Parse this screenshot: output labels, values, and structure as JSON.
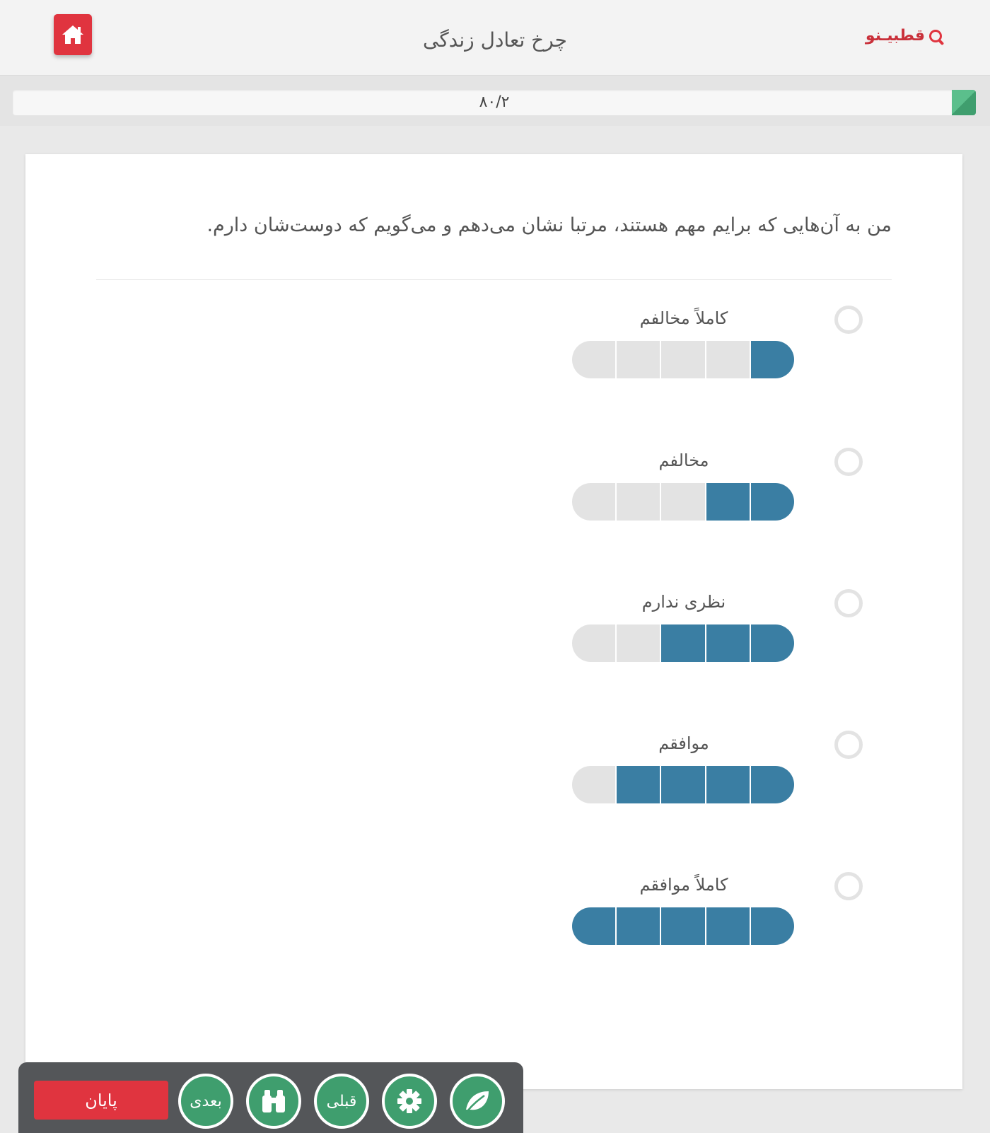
{
  "header": {
    "title": "چرخ تعادل زندگی",
    "logo_text": "قطبیـنو",
    "home_icon": "home-icon"
  },
  "progress": {
    "label": "۸۰/۲",
    "current": 2,
    "total": 80,
    "fraction": 0.025
  },
  "question": {
    "text": "من به آن‌هایی که برایم مهم هستند، مرتبا نشان می‌دهم و می‌گویم که دوست‌شان دارم."
  },
  "options": [
    {
      "label": "کاملاً مخالفم",
      "level": 1,
      "selected": false
    },
    {
      "label": "مخالفم",
      "level": 2,
      "selected": false
    },
    {
      "label": "نظری ندارم",
      "level": 3,
      "selected": false
    },
    {
      "label": "موافقم",
      "level": 4,
      "selected": false
    },
    {
      "label": "کاملاً موافقم",
      "level": 5,
      "selected": false
    }
  ],
  "scale_max": 5,
  "toolbar": {
    "end_label": "پایان",
    "next_label": "بعدی",
    "prev_label": "قبلی",
    "binoculars_icon": "binoculars-icon",
    "settings_icon": "gear-icon",
    "leaf_icon": "leaf-icon"
  },
  "colors": {
    "brand_red": "#e0343f",
    "scale_blue": "#3a7ea3",
    "scale_empty": "#e3e3e3",
    "action_green": "#3f9e6e",
    "toolbar_bg": "#545659"
  }
}
